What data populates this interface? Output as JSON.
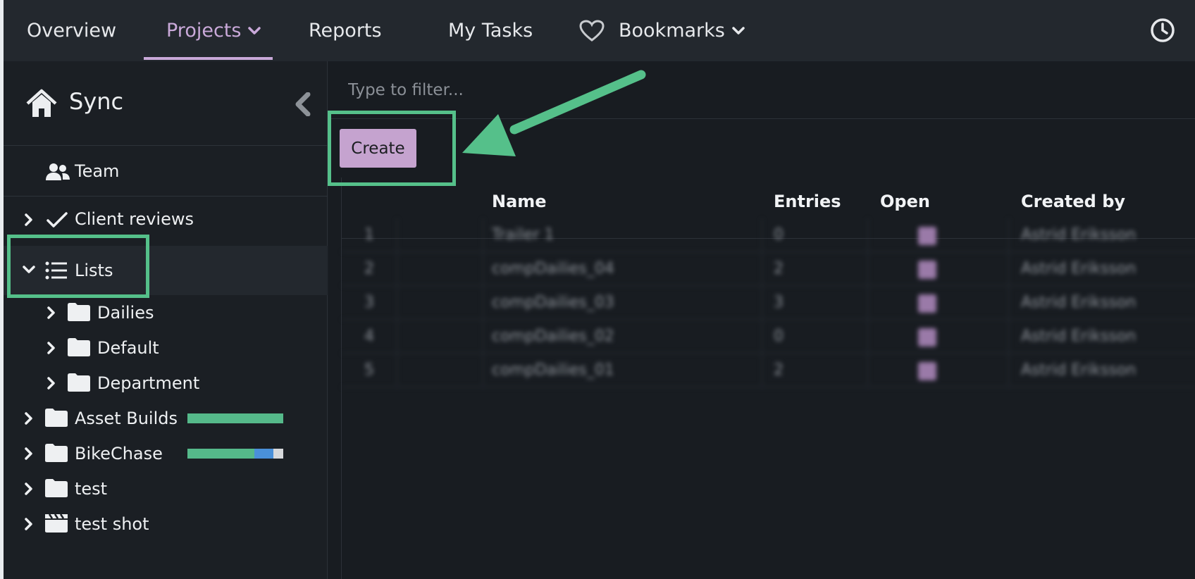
{
  "nav": {
    "items": [
      {
        "label": "Overview"
      },
      {
        "label": "Projects"
      },
      {
        "label": "Reports"
      },
      {
        "label": "My Tasks"
      },
      {
        "label": "Bookmarks"
      }
    ]
  },
  "sidebar": {
    "title": "Sync",
    "team_label": "Team",
    "items": [
      {
        "label": "Client reviews",
        "icon": "checkmark-icon"
      },
      {
        "label": "Lists",
        "icon": "list-icon"
      },
      {
        "label": "Dailies",
        "icon": "folder-icon"
      },
      {
        "label": "Default",
        "icon": "folder-icon"
      },
      {
        "label": "Department",
        "icon": "folder-icon"
      },
      {
        "label": "Asset Builds",
        "icon": "folder-icon",
        "progress": [
          {
            "fraction": 1.0,
            "color": "#55b98a"
          }
        ]
      },
      {
        "label": "BikeChase",
        "icon": "folder-icon",
        "progress": [
          {
            "fraction": 0.7,
            "color": "#55b98a"
          },
          {
            "fraction": 0.2,
            "color": "#4a90d9"
          },
          {
            "fraction": 0.1,
            "color": "#d7d9dc"
          }
        ]
      },
      {
        "label": "test",
        "icon": "folder-icon"
      },
      {
        "label": "test shot",
        "icon": "clapperboard-icon"
      }
    ]
  },
  "main": {
    "filter_placeholder": "Type to filter...",
    "create_label": "Create",
    "columns": [
      "Name",
      "Entries",
      "Open",
      "Created by"
    ],
    "rows": [
      {
        "num": "1",
        "name": "Trailer 1",
        "entries": "0",
        "open": true,
        "created_by": "Astrid Eriksson"
      },
      {
        "num": "2",
        "name": "compDailies_04",
        "entries": "2",
        "open": true,
        "created_by": "Astrid Eriksson"
      },
      {
        "num": "3",
        "name": "compDailies_03",
        "entries": "3",
        "open": true,
        "created_by": "Astrid Eriksson"
      },
      {
        "num": "4",
        "name": "compDailies_02",
        "entries": "0",
        "open": true,
        "created_by": "Astrid Eriksson"
      },
      {
        "num": "5",
        "name": "compDailies_01",
        "entries": "2",
        "open": true,
        "created_by": "Astrid Eriksson"
      }
    ]
  },
  "colors": {
    "accent": "#c9a9d9",
    "highlight": "#55c08a",
    "progress_green": "#55b98a",
    "progress_blue": "#4a90d9"
  }
}
